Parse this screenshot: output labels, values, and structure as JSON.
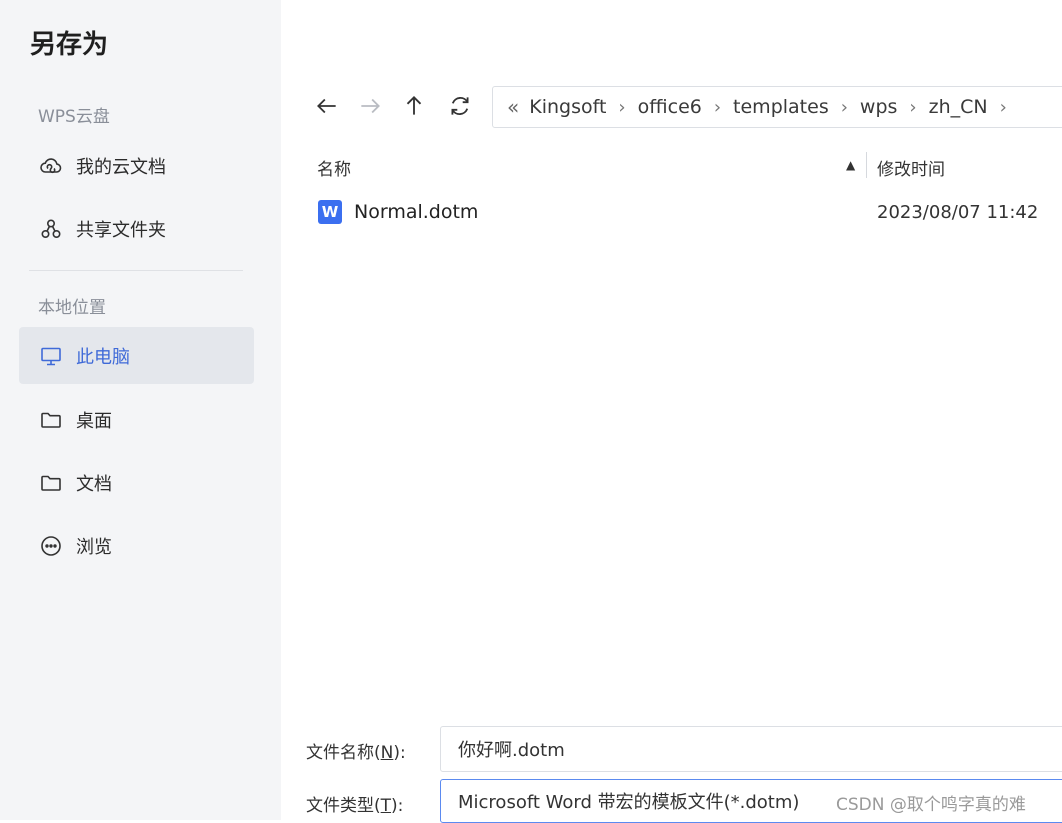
{
  "dialog": {
    "title": "另存为"
  },
  "sidebar": {
    "cloud_section": "WPS云盘",
    "cloud_items": [
      {
        "label": "我的云文档",
        "icon": "cloud-icon"
      },
      {
        "label": "共享文件夹",
        "icon": "share-folder-icon"
      }
    ],
    "local_section": "本地位置",
    "local_items": [
      {
        "label": "此电脑",
        "icon": "monitor-icon",
        "active": true
      },
      {
        "label": "桌面",
        "icon": "folder-icon"
      },
      {
        "label": "文档",
        "icon": "folder-icon"
      },
      {
        "label": "浏览",
        "icon": "more-circle-icon"
      }
    ]
  },
  "toolbar": {
    "back_icon": "arrow-left-icon",
    "forward_icon": "arrow-right-icon",
    "up_icon": "arrow-up-icon",
    "refresh_icon": "refresh-icon"
  },
  "breadcrumb": {
    "lead": "«",
    "items": [
      "Kingsoft",
      "office6",
      "templates",
      "wps",
      "zh_CN"
    ],
    "separator": "›"
  },
  "file_list": {
    "columns": {
      "name": "名称",
      "modified": "修改时间"
    },
    "sort_indicator": "▲",
    "rows": [
      {
        "name": "Normal.dotm",
        "modified": "2023/08/07 11:42",
        "icon_letter": "W"
      }
    ]
  },
  "form": {
    "filename_label": "文件名称",
    "filename_mnemonic": "N",
    "filename_value": "你好啊.dotm",
    "filetype_label": "文件类型",
    "filetype_mnemonic": "T",
    "filetype_value": "Microsoft Word 带宏的模板文件(*.dotm)"
  },
  "watermark": "CSDN @取个鸣字真的难",
  "colors": {
    "accent": "#3f6ad8",
    "sidebar_bg": "#f4f5f7",
    "word_icon": "#3b6ff0"
  }
}
